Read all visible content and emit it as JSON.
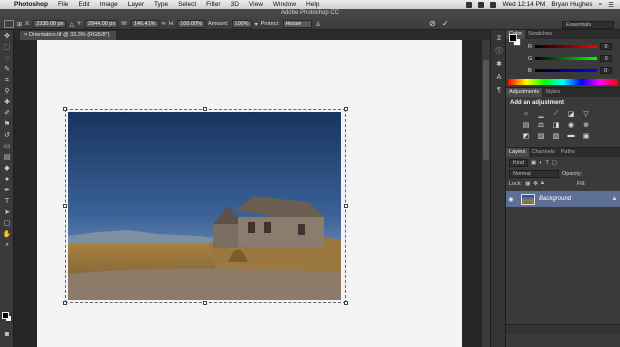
{
  "menubar": {
    "apple": "",
    "app_name": "Photoshop",
    "items": [
      "File",
      "Edit",
      "Image",
      "Layer",
      "Type",
      "Select",
      "Filter",
      "3D",
      "View",
      "Window",
      "Help"
    ],
    "clock": "Wed 12:14 PM",
    "user": "Bryan Hughes"
  },
  "options_bar": {
    "window_title": "Adobe Photoshop CC",
    "x_label": "X:",
    "x_value": "2330.00 px",
    "y_label": "Y:",
    "y_value": "2944.00 px",
    "w_label": "W:",
    "w_value": "146.41%",
    "h_label": "H:",
    "h_value": "100.00%",
    "amount_label": "Amount:",
    "amount_value": "100%",
    "protect_label": "Protect:",
    "protect_value": "House",
    "cancel_icon": "cancel-icon",
    "commit_icon": "check-icon",
    "workspace": "Essentials"
  },
  "document": {
    "tab_label": "Orientation.tif @ 33.3% (RGB/8*)"
  },
  "color_panel": {
    "tabs": [
      "Color",
      "Swatches"
    ],
    "r_label": "R",
    "g_label": "G",
    "b_label": "B",
    "r_value": "0",
    "g_value": "0",
    "b_value": "0",
    "colors": {
      "r_bar": "#c82020",
      "g_bar": "#20a020",
      "b_bar": "#2040c8"
    }
  },
  "adjustments_panel": {
    "tabs": [
      "Adjustments",
      "Styles"
    ],
    "title": "Add an adjustment"
  },
  "layers_panel": {
    "tabs": [
      "Layers",
      "Channels",
      "Paths"
    ],
    "kind_filter": "Kind",
    "blend_mode": "Normal",
    "opacity_label": "Opacity:",
    "lock_label": "Lock:",
    "fill_label": "Fill:",
    "layer_name": "Background"
  }
}
